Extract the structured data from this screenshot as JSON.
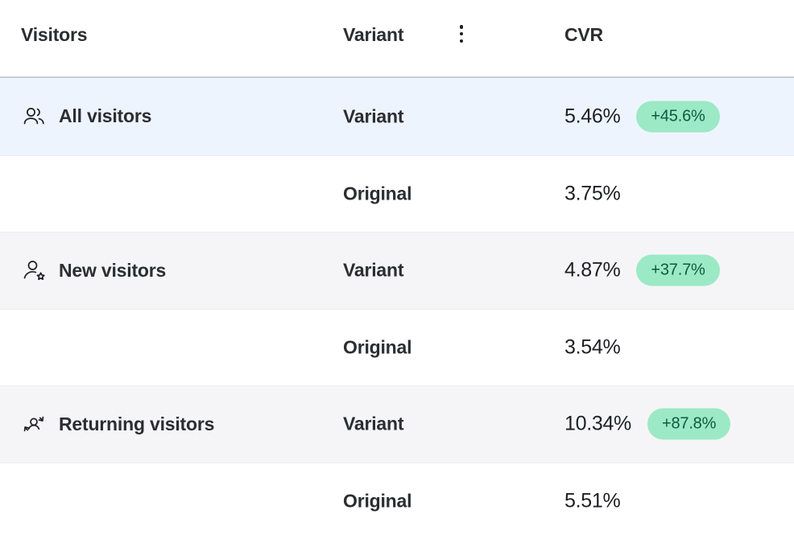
{
  "colors": {
    "badge_bg": "#9ce9c5",
    "badge_text": "#0d5b40",
    "row_highlight_bg": "#eef4fd",
    "row_alt_bg": "#f5f5f7",
    "row_default_bg": "#ffffff",
    "text_primary": "#2b2d31",
    "header_border": "#c9ccd1"
  },
  "header": {
    "col_visitors": "Visitors",
    "col_variant": "Variant",
    "col_cvr": "CVR",
    "menu_icon": "vertical-dots-icon"
  },
  "rows": [
    {
      "segment": "All visitors",
      "icon": "users-group-icon",
      "variant": "Variant",
      "cvr": "5.46%",
      "delta": "+45.6%",
      "has_delta": true,
      "bg": "bg-blue"
    },
    {
      "segment": "",
      "icon": "",
      "variant": "Original",
      "cvr": "3.75%",
      "delta": "",
      "has_delta": false,
      "bg": "bg-white"
    },
    {
      "segment": "New visitors",
      "icon": "user-star-icon",
      "variant": "Variant",
      "cvr": "4.87%",
      "delta": "+37.7%",
      "has_delta": true,
      "bg": "bg-gray"
    },
    {
      "segment": "",
      "icon": "",
      "variant": "Original",
      "cvr": "3.54%",
      "delta": "",
      "has_delta": false,
      "bg": "bg-white"
    },
    {
      "segment": "Returning visitors",
      "icon": "user-return-icon",
      "variant": "Variant",
      "cvr": "10.34%",
      "delta": "+87.8%",
      "has_delta": true,
      "bg": "bg-gray"
    },
    {
      "segment": "",
      "icon": "",
      "variant": "Original",
      "cvr": "5.51%",
      "delta": "",
      "has_delta": false,
      "bg": "bg-white"
    }
  ]
}
